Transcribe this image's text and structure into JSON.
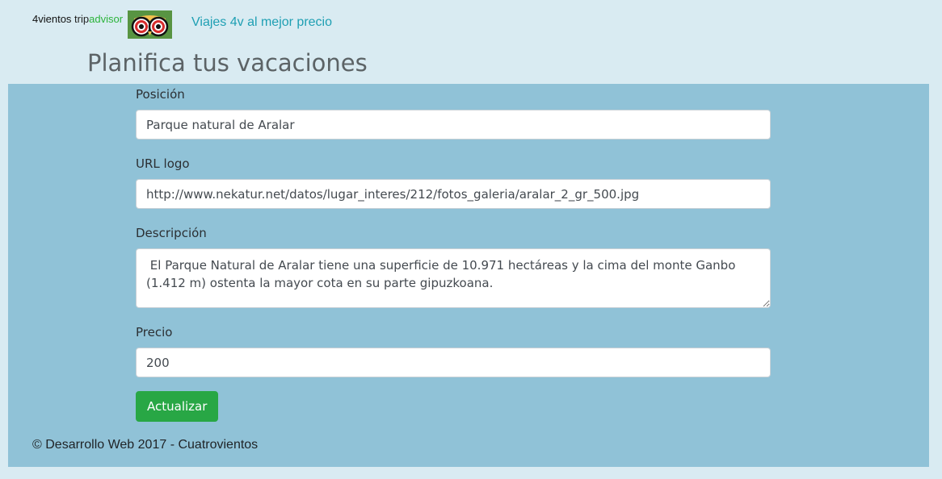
{
  "header": {
    "brand_prefix": "4vientos ",
    "brand_trip": "trip",
    "brand_advisor": "advisor",
    "logo_icon": "owl-icon",
    "tagline": "Viajes 4v al mejor precio"
  },
  "page": {
    "title": "Planifica tus vacaciones"
  },
  "form": {
    "posicion": {
      "label": "Posición",
      "value": "Parque natural de Aralar"
    },
    "url_logo": {
      "label": "URL logo",
      "value": "http://www.nekatur.net/datos/lugar_interes/212/fotos_galeria/aralar_2_gr_500.jpg"
    },
    "descripcion": {
      "label": "Descripción",
      "value": " El Parque Natural de Aralar tiene una superficie de 10.971 hectáreas y la cima del monte Ganbo (1.412 m) ostenta la mayor cota en su parte gipuzkoana."
    },
    "precio": {
      "label": "Precio",
      "value": "200"
    },
    "submit_label": "Actualizar"
  },
  "footer": {
    "text": "© Desarrollo Web 2017 - Cuatrovientos"
  },
  "colors": {
    "page_background": "#d9ebf2",
    "panel_background": "#90c2d7",
    "tagline_link": "#1e9fb3",
    "advisor_green": "#2bb33a",
    "submit_button": "#28a745",
    "logo_background": "#589442"
  }
}
